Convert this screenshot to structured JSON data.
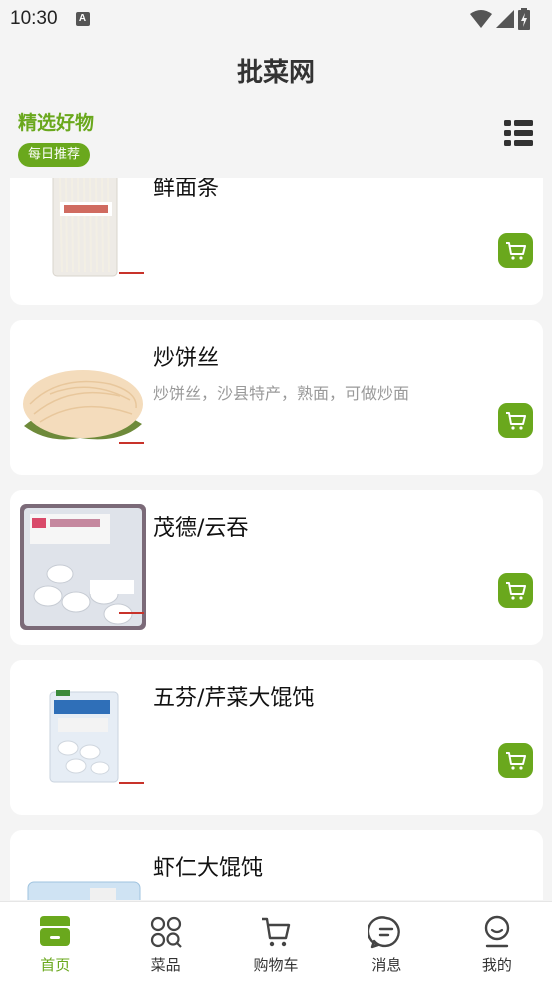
{
  "status": {
    "time": "10:30",
    "indicator": "A"
  },
  "header": {
    "title": "批菜网"
  },
  "section": {
    "title": "精选好物",
    "badge": "每日推荐"
  },
  "icons": {
    "list_toggle": "list-icon",
    "cart": "shopping-cart-icon",
    "wifi": "wifi-icon",
    "signal": "signal-icon",
    "battery": "battery-charging-icon"
  },
  "products": [
    {
      "name": "鲜面条",
      "desc": ""
    },
    {
      "name": "炒饼丝",
      "desc": "炒饼丝，沙县特产，熟面，可做炒面"
    },
    {
      "name": "茂德/云吞",
      "desc": ""
    },
    {
      "name": "五芬/芹菜大馄饨",
      "desc": ""
    },
    {
      "name": "虾仁大馄饨",
      "desc": ""
    }
  ],
  "nav": [
    {
      "label": "首页",
      "icon": "home-shop-icon",
      "active": true
    },
    {
      "label": "菜品",
      "icon": "category-grid-icon",
      "active": false
    },
    {
      "label": "购物车",
      "icon": "cart-icon",
      "active": false
    },
    {
      "label": "消息",
      "icon": "message-icon",
      "active": false
    },
    {
      "label": "我的",
      "icon": "profile-icon",
      "active": false
    }
  ],
  "colors": {
    "accent": "#6aa81d",
    "background": "#f4f4f4",
    "card": "#ffffff",
    "muted_text": "#999999"
  }
}
